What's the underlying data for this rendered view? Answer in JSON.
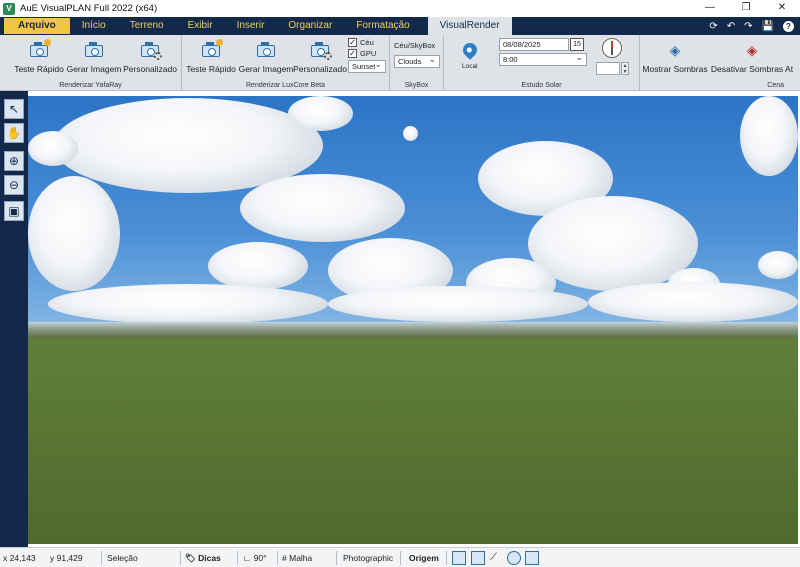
{
  "window": {
    "title": "AuE VisualPLAN Full 2022 (x64)",
    "controls": [
      "—",
      "❐",
      "✕"
    ]
  },
  "menu": {
    "tabs": [
      "Arquivo",
      "Início",
      "Terreno",
      "Exibir",
      "Inserir",
      "Organizar",
      "Formatação",
      "VisualRender"
    ],
    "active": "VisualRender",
    "quick": [
      "⟳",
      "↶",
      "↷",
      "💾",
      "?"
    ]
  },
  "ribbon": {
    "yafaray": {
      "label": "Renderizar YafaRay",
      "buttons": [
        "Teste Rápido",
        "Gerar Imagem",
        "Personalizado"
      ]
    },
    "luxcore": {
      "label": "Renderizar LuxCore Beta",
      "buttons": [
        "Teste Rápido",
        "Gerar Imagem",
        "Personalizado"
      ],
      "ceu": "Céu",
      "gpu": "GPU",
      "preset": "Sunset"
    },
    "skybox": {
      "label": "SkyBox",
      "toggle": "Céu/SkyBox",
      "value": "Clouds"
    },
    "solar": {
      "label": "Estudo Solar",
      "local": "Local",
      "date": "08/08/2025",
      "cal_day": "15",
      "time": "8:00"
    },
    "cena": {
      "label": "Cena",
      "show_shadows": "Mostrar Sombras",
      "hide_shadows": "Desativar Sombras At"
    }
  },
  "status": {
    "x": "x 24,143",
    "y": "y 91,429",
    "selection": "Seleção",
    "tips": "Dicas",
    "angle": "90°",
    "grid": "Malha",
    "mode": "Photographic",
    "origin": "Origem"
  }
}
